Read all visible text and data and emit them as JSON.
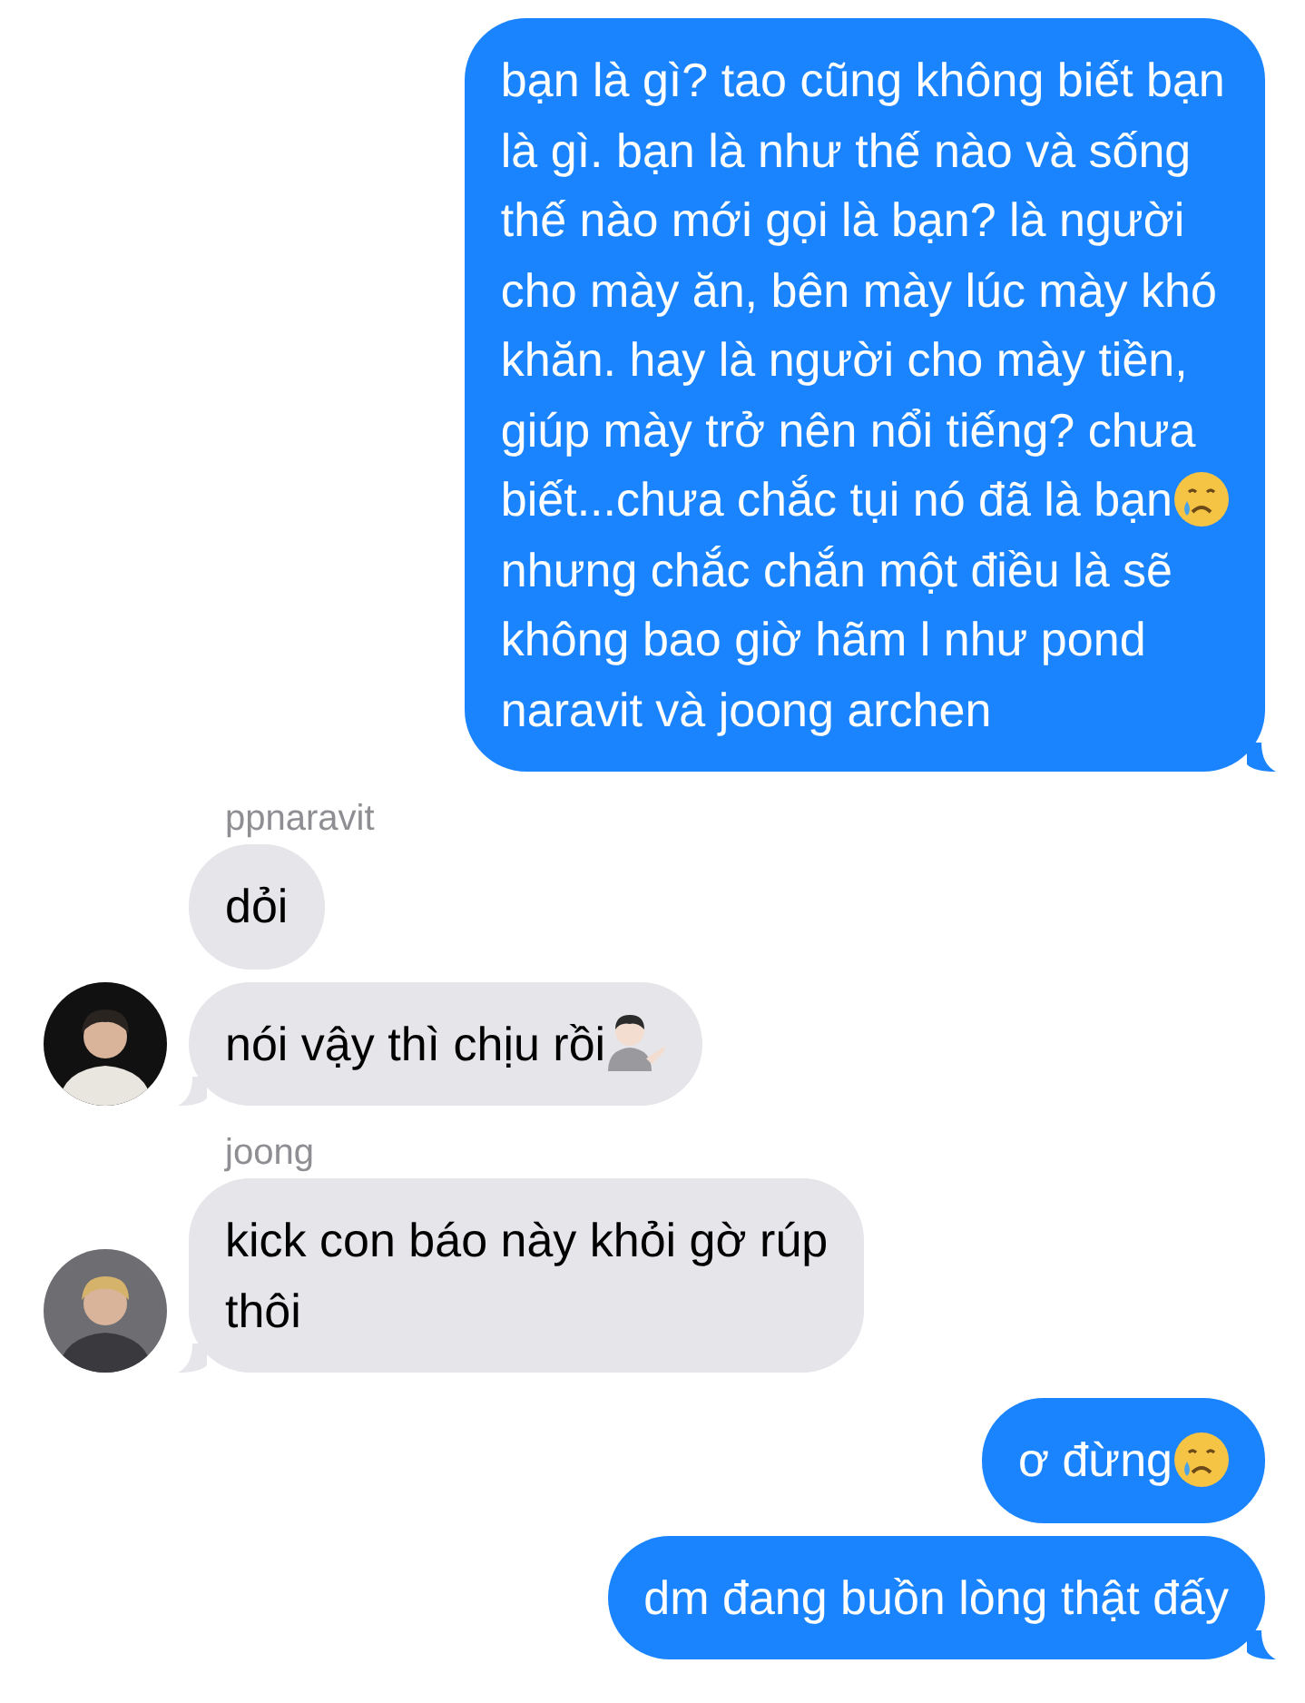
{
  "groups": [
    {
      "kind": "outgoing",
      "bubbles": [
        {
          "segments": [
            {
              "kind": "text",
              "text": "bạn là gì? tao cũng không biết bạn\nlà gì. bạn là như thế nào và sống\nthế nào mới gọi là bạn? là người\ncho mày ăn, bên mày lúc mày khó\nkhăn. hay là người cho mày tiền,\ngiúp mày trở nên nổi tiếng? chưa"
            },
            {
              "kind": "text",
              "text": "biết...chưa chắc tụi nó đã là bạn"
            },
            {
              "kind": "crying_face"
            },
            {
              "kind": "text",
              "text": "nhưng chắc chắn một điều là sẽ\nkhông bao giờ hãm l như pond\nnaravit và joong archen"
            }
          ]
        }
      ]
    },
    {
      "kind": "incoming",
      "sender": "ppnaravit",
      "avatar": {
        "kind": "picture"
      },
      "bubbles": [
        {
          "segments": [
            {
              "kind": "text",
              "text": "dỏi"
            }
          ]
        },
        {
          "segments": [
            {
              "kind": "text",
              "text": "nói vậy thì chịu rồi"
            },
            {
              "kind": "tipping_hand"
            }
          ]
        }
      ]
    },
    {
      "kind": "incoming",
      "sender": "joong",
      "avatar": {
        "kind": "picture"
      },
      "bubbles": [
        {
          "segments": [
            {
              "kind": "text",
              "text": "kick con báo này khỏi gờ rúp\nthôi"
            }
          ]
        }
      ]
    },
    {
      "kind": "outgoing",
      "bubbles": [
        {
          "segments": [
            {
              "kind": "text",
              "text": "ơ đừng"
            },
            {
              "kind": "crying_face"
            }
          ]
        },
        {
          "segments": [
            {
              "kind": "text",
              "text": "dm đang buồn lòng thật đấy"
            }
          ]
        }
      ]
    }
  ]
}
